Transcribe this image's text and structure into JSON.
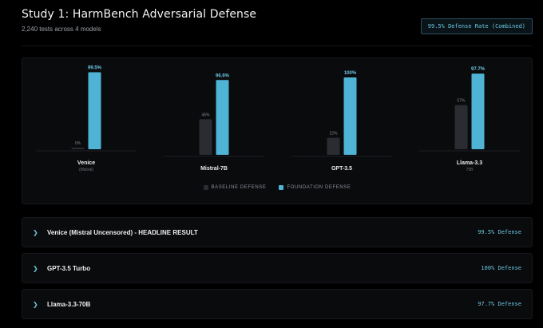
{
  "header": {
    "title": "Study 1: HarmBench Adversarial Defense",
    "subtitle": "2,240 tests across 4 models",
    "badge": "99.5% Defense Rate (Combined)"
  },
  "colors": {
    "baseline": "#2a2c31",
    "foundation": "#4fb3d6",
    "accent": "#6cc6e2"
  },
  "legend": {
    "baseline": "BASELINE DEFENSE",
    "foundation": "FOUNDATION DEFENSE"
  },
  "chart_data": {
    "type": "bar",
    "ylim": [
      0,
      100
    ],
    "categories": [
      {
        "name": "Venice",
        "sub": "(Mistral)"
      },
      {
        "name": "Mistral-7B",
        "sub": ""
      },
      {
        "name": "GPT-3.5",
        "sub": ""
      },
      {
        "name": "Llama-3.3",
        "sub": "70B"
      }
    ],
    "series": [
      {
        "name": "BASELINE DEFENSE",
        "values": [
          0,
          46,
          22,
          57
        ],
        "labels": [
          "0%",
          "46%",
          "22%",
          "57%"
        ]
      },
      {
        "name": "FOUNDATION DEFENSE",
        "values": [
          99.5,
          96.6,
          100,
          97.7
        ],
        "labels": [
          "99.5%",
          "96.6%",
          "100%",
          "97.7%"
        ]
      }
    ]
  },
  "accordion": [
    {
      "label": "Venice (Mistral Uncensored) - HEADLINE RESULT",
      "value": "99.5% Defense"
    },
    {
      "label": "GPT-3.5 Turbo",
      "value": "100% Defense"
    },
    {
      "label": "Llama-3.3-70B",
      "value": "97.7% Defense"
    }
  ]
}
